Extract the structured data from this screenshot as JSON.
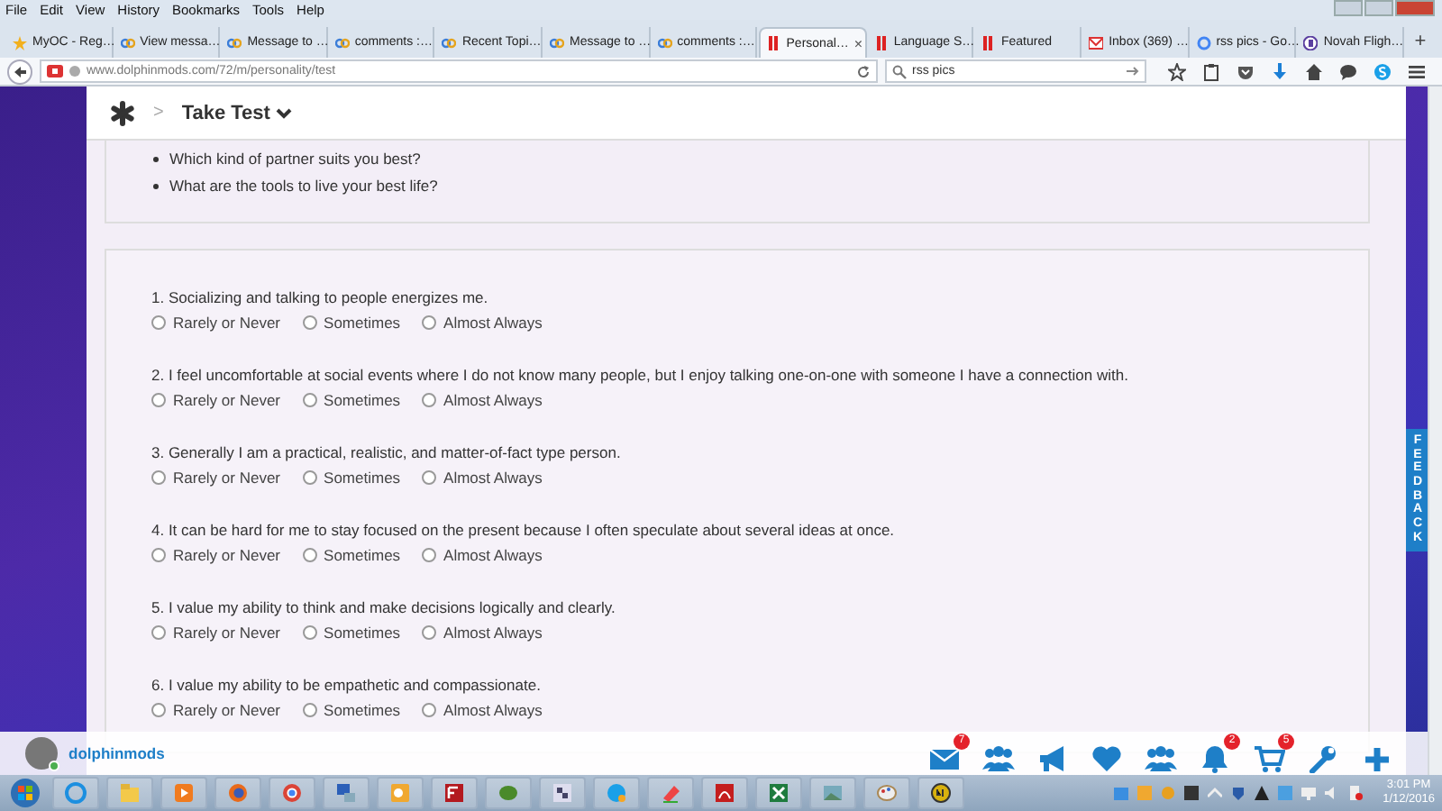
{
  "menu_bar": {
    "items": [
      "File",
      "Edit",
      "View",
      "History",
      "Bookmarks",
      "Tools",
      "Help"
    ]
  },
  "tabs": [
    {
      "label": "MyOC - Reg…",
      "kind": "star",
      "selected": false
    },
    {
      "label": "View messa…",
      "kind": "loop",
      "selected": false
    },
    {
      "label": "Message to …",
      "kind": "loop",
      "selected": false
    },
    {
      "label": "comments :…",
      "kind": "loop",
      "selected": false
    },
    {
      "label": "Recent Topi…",
      "kind": "loop",
      "selected": false
    },
    {
      "label": "Message to …",
      "kind": "loop",
      "selected": false
    },
    {
      "label": "comments :…",
      "kind": "loop",
      "selected": false
    },
    {
      "label": "Personal…",
      "kind": "bars",
      "selected": true,
      "close": "×"
    },
    {
      "label": "Language S…",
      "kind": "bars",
      "selected": false
    },
    {
      "label": "Featured",
      "kind": "bars",
      "selected": false
    },
    {
      "label": "Inbox (369) …",
      "kind": "mail",
      "selected": false
    },
    {
      "label": "rss pics - Go…",
      "kind": "g",
      "selected": false
    },
    {
      "label": "Novah Fligh…",
      "kind": "b",
      "selected": false
    }
  ],
  "new_tab": "+",
  "address_bar": {
    "value": "www.dolphinmods.com/72/m/personality/test"
  },
  "search": {
    "value": "rss pics"
  },
  "header": {
    "separator": ">",
    "title": "Take Test"
  },
  "topics": [
    "Which kind of partner suits you best?",
    "What are the tools to live your best life?"
  ],
  "questions": [
    {
      "text": "1. Socializing and talking to people energizes me.",
      "options": [
        {
          "label": "Rarely or Never",
          "selected": false
        },
        {
          "label": "Sometimes",
          "selected": false
        },
        {
          "label": "Almost Always",
          "selected": false
        }
      ]
    },
    {
      "text": "2. I feel uncomfortable at social events where I do not know many people, but I enjoy talking one-on-one with someone I have a connection with.",
      "options": [
        {
          "label": "Rarely or Never",
          "selected": false
        },
        {
          "label": "Sometimes",
          "selected": false
        },
        {
          "label": "Almost Always",
          "selected": false
        }
      ]
    },
    {
      "text": "3. Generally I am a practical, realistic, and matter-of-fact type person.",
      "options": [
        {
          "label": "Rarely or Never",
          "selected": false
        },
        {
          "label": "Sometimes",
          "selected": false
        },
        {
          "label": "Almost Always",
          "selected": false
        }
      ]
    },
    {
      "text": "4. It can be hard for me to stay focused on the present because I often speculate about several ideas at once.",
      "options": [
        {
          "label": "Rarely or Never",
          "selected": false
        },
        {
          "label": "Sometimes",
          "selected": false
        },
        {
          "label": "Almost Always",
          "selected": false
        }
      ]
    },
    {
      "text": "5. I value my ability to think and make decisions logically and clearly.",
      "options": [
        {
          "label": "Rarely or Never",
          "selected": false
        },
        {
          "label": "Sometimes",
          "selected": false
        },
        {
          "label": "Almost Always",
          "selected": false
        }
      ]
    },
    {
      "text": "6. I value my ability to be empathetic and compassionate.",
      "options": [
        {
          "label": "Rarely or Never",
          "selected": false
        },
        {
          "label": "Sometimes",
          "selected": false
        },
        {
          "label": "Almost Always",
          "selected": false
        }
      ]
    }
  ],
  "feedback_tab": {
    "label": "FEEDBACK"
  },
  "footer": {
    "username": "dolphinmods",
    "online": true,
    "icons": [
      {
        "kind": "mail",
        "badge": "7"
      },
      {
        "kind": "group"
      },
      {
        "kind": "megaphone"
      },
      {
        "kind": "heart"
      },
      {
        "kind": "group"
      },
      {
        "kind": "bell",
        "badge": "2"
      },
      {
        "kind": "cart",
        "badge": "5"
      },
      {
        "kind": "wrench"
      },
      {
        "kind": "plus"
      }
    ]
  },
  "taskbar": {
    "time": "3:01 PM",
    "date": "1/12/2016"
  }
}
